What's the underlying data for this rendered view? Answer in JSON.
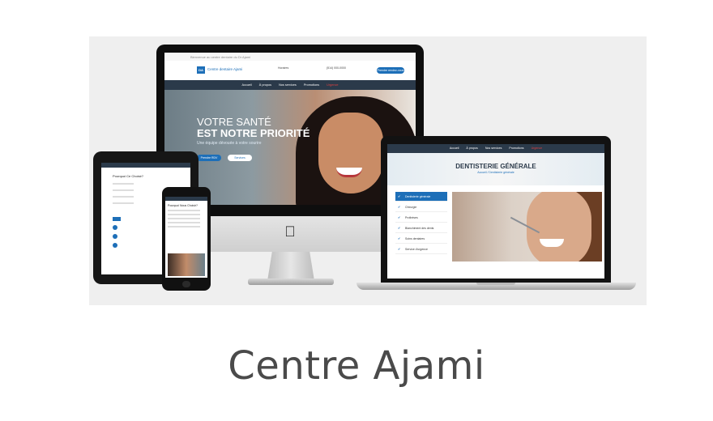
{
  "imac": {
    "topbar_text": "Bienvenue au centre dentaire du Dr Ajami",
    "logo_text": "Centre dentaire Ajami",
    "contact_1": "Horaires",
    "contact_2": "(514) 000-0000",
    "rdv_button": "Prendre rendez-vous",
    "nav": [
      "Accueil",
      "À propos",
      "Nos services",
      "Promotions",
      "Urgence"
    ],
    "hero_line1": "VOTRE SANTÉ",
    "hero_line2": "EST NOTRE PRIORITÉ",
    "hero_sub": "Une équipe dévouée à votre sourire",
    "hero_btn1": "Prendre RDV",
    "hero_btn2": "Services"
  },
  "laptop": {
    "nav": [
      "Accueil",
      "À propos",
      "Nos services",
      "Promotions",
      "Urgence"
    ],
    "banner_title": "DENTISTERIE GÉNÉRALE",
    "banner_crumb": "Accueil / Dentisterie générale",
    "side_items": [
      "Dentisterie générale",
      "Chirurgie",
      "Prothèses",
      "Blanchiment des dents",
      "Soins dentaires",
      "Service d'urgence"
    ]
  },
  "tablet": {
    "title": "Pourquoi Ce Choisir?"
  },
  "phone": {
    "title": "Pourquoi Nous Choisir?"
  },
  "caption": "Centre Ajami",
  "colors": {
    "brand_blue": "#1d6fb8",
    "nav_dark": "#2b3a4a",
    "caption": "#4a4a4a"
  }
}
